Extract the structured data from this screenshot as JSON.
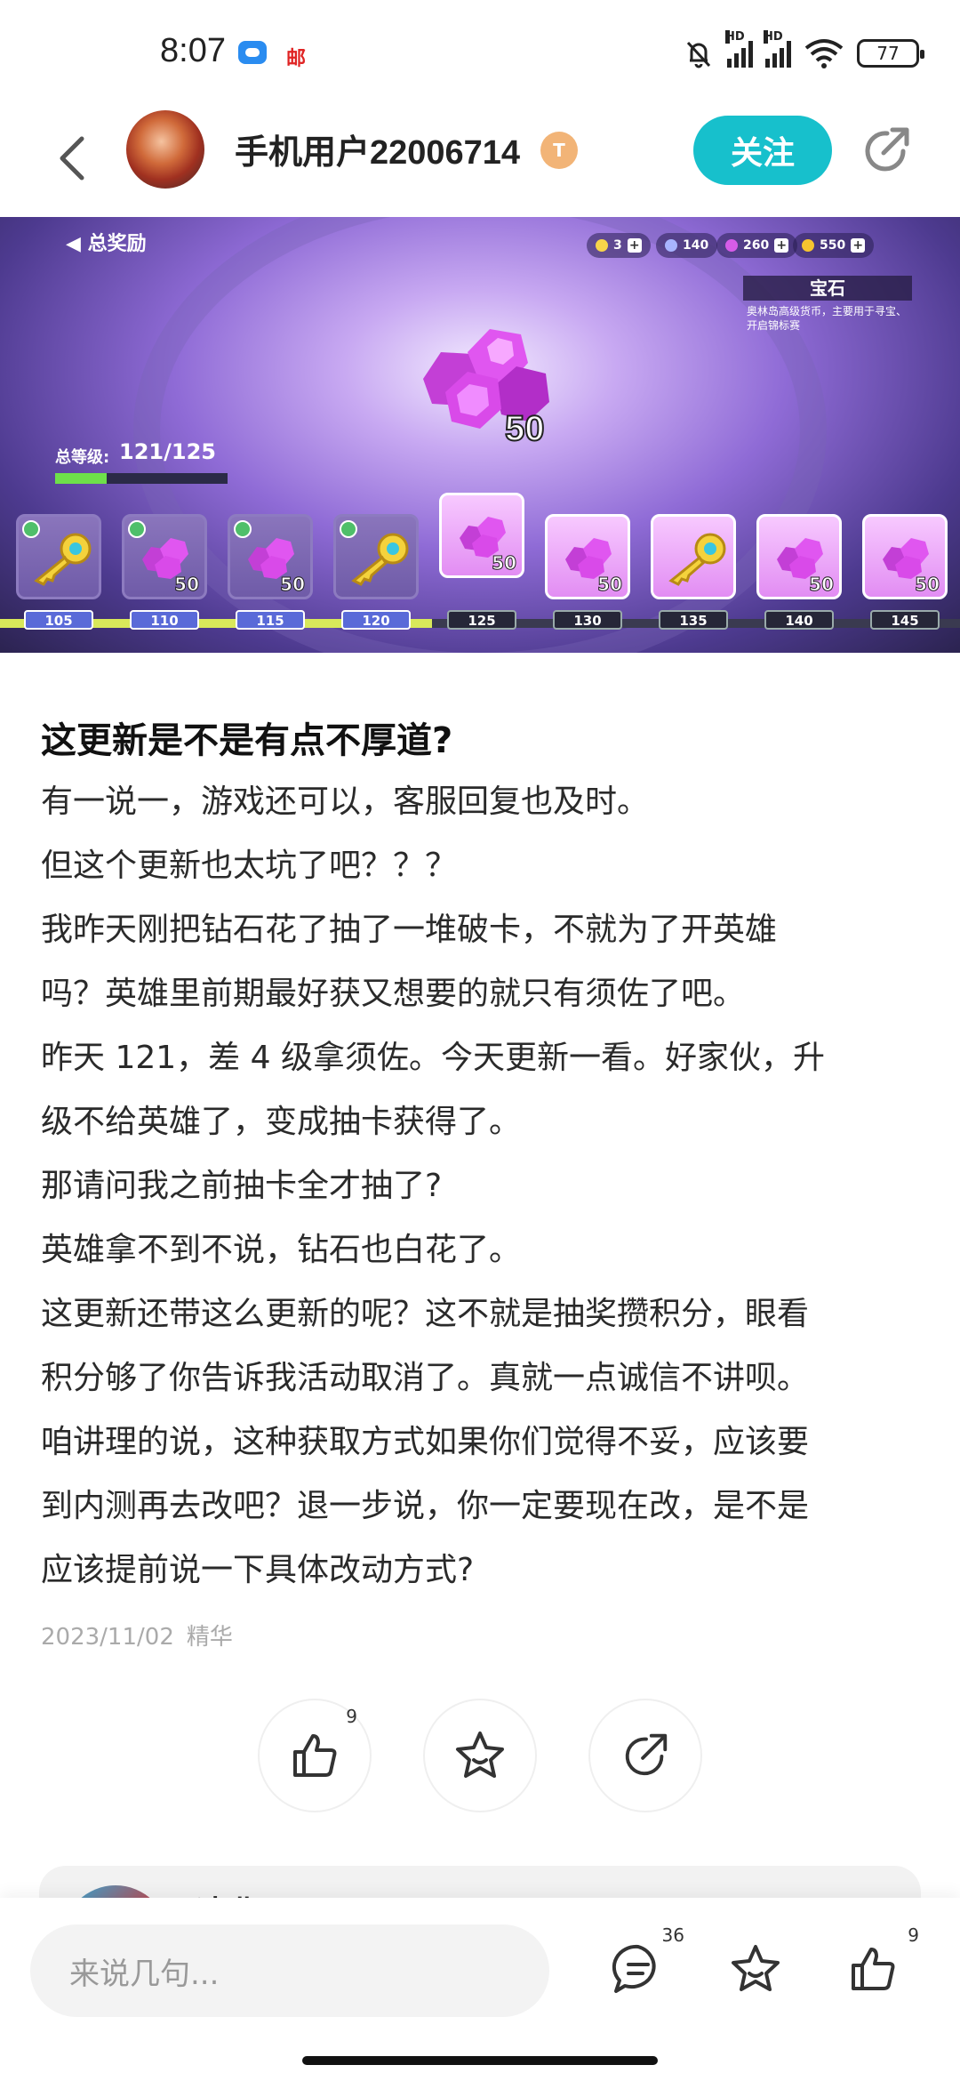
{
  "status_bar": {
    "time": "8:07",
    "mail_label": "邮",
    "battery": "77",
    "signal_label_1": "HD",
    "signal_label_2": "HD"
  },
  "header": {
    "username": "手机用户22006714",
    "level_badge": "T",
    "follow_label": "关注"
  },
  "banner": {
    "back_label": "总奖励",
    "resources": [
      {
        "value": "3",
        "color": "#f7d44a"
      },
      {
        "value": "140",
        "color": "#a8b4ff"
      },
      {
        "value": "260",
        "color": "#d65ce8"
      },
      {
        "value": "550",
        "color": "#f6c42f"
      }
    ],
    "info_title": "宝石",
    "info_desc": "奥林岛高级货币，主要用于寻宝、开启锦标赛",
    "reward_count": "50",
    "level_label": "总等级:",
    "level_value": "121/125",
    "level_progress": 0.3,
    "track_progress": 0.45,
    "items": [
      {
        "type": "key",
        "count": "",
        "level": "105",
        "claimed": true
      },
      {
        "type": "gem",
        "count": "50",
        "level": "110",
        "claimed": true
      },
      {
        "type": "gem",
        "count": "50",
        "level": "115",
        "claimed": true
      },
      {
        "type": "key",
        "count": "",
        "level": "120",
        "claimed": true
      },
      {
        "type": "gem",
        "count": "50",
        "level": "125",
        "claimed": false
      },
      {
        "type": "gem",
        "count": "50",
        "level": "130",
        "claimed": false
      },
      {
        "type": "key",
        "count": "",
        "level": "135",
        "claimed": false
      },
      {
        "type": "gem",
        "count": "50",
        "level": "140",
        "claimed": false
      },
      {
        "type": "gem",
        "count": "50",
        "level": "145",
        "claimed": false
      }
    ]
  },
  "post": {
    "title": "这更新是不是有点不厚道?",
    "lines": [
      "有一说一，游戏还可以，客服回复也及时。",
      "但这个更新也太坑了吧？？？",
      "我昨天刚把钻石花了抽了一堆破卡，不就为了开英雄",
      "吗？英雄里前期最好获又想要的就只有须佐了吧。",
      "昨天 121，差 4 级拿须佐。今天更新一看。好家伙，升",
      "级不给英雄了，变成抽卡获得了。",
      "那请问我之前抽卡全才抽了?",
      "英雄拿不到不说，钻石也白花了。",
      "这更新还带这么更新的呢？这不就是抽奖攒积分，眼看",
      "积分够了你告诉我活动取消了。真就一点诚信不讲呗。",
      "咱讲理的说，这种获取方式如果你们觉得不妥，应该要",
      "到内测再去改吧？退一步说，你一定要现在改，是不是",
      "应该提前说一下具体改动方式?"
    ],
    "date": "2023/11/02",
    "tag": "精华"
  },
  "actions": {
    "like_count": "9"
  },
  "comment_preview": {
    "text": "凌兆 · 工具..."
  },
  "bottom_bar": {
    "placeholder": "来说几句...",
    "comment_count": "36",
    "like_count": "9"
  }
}
